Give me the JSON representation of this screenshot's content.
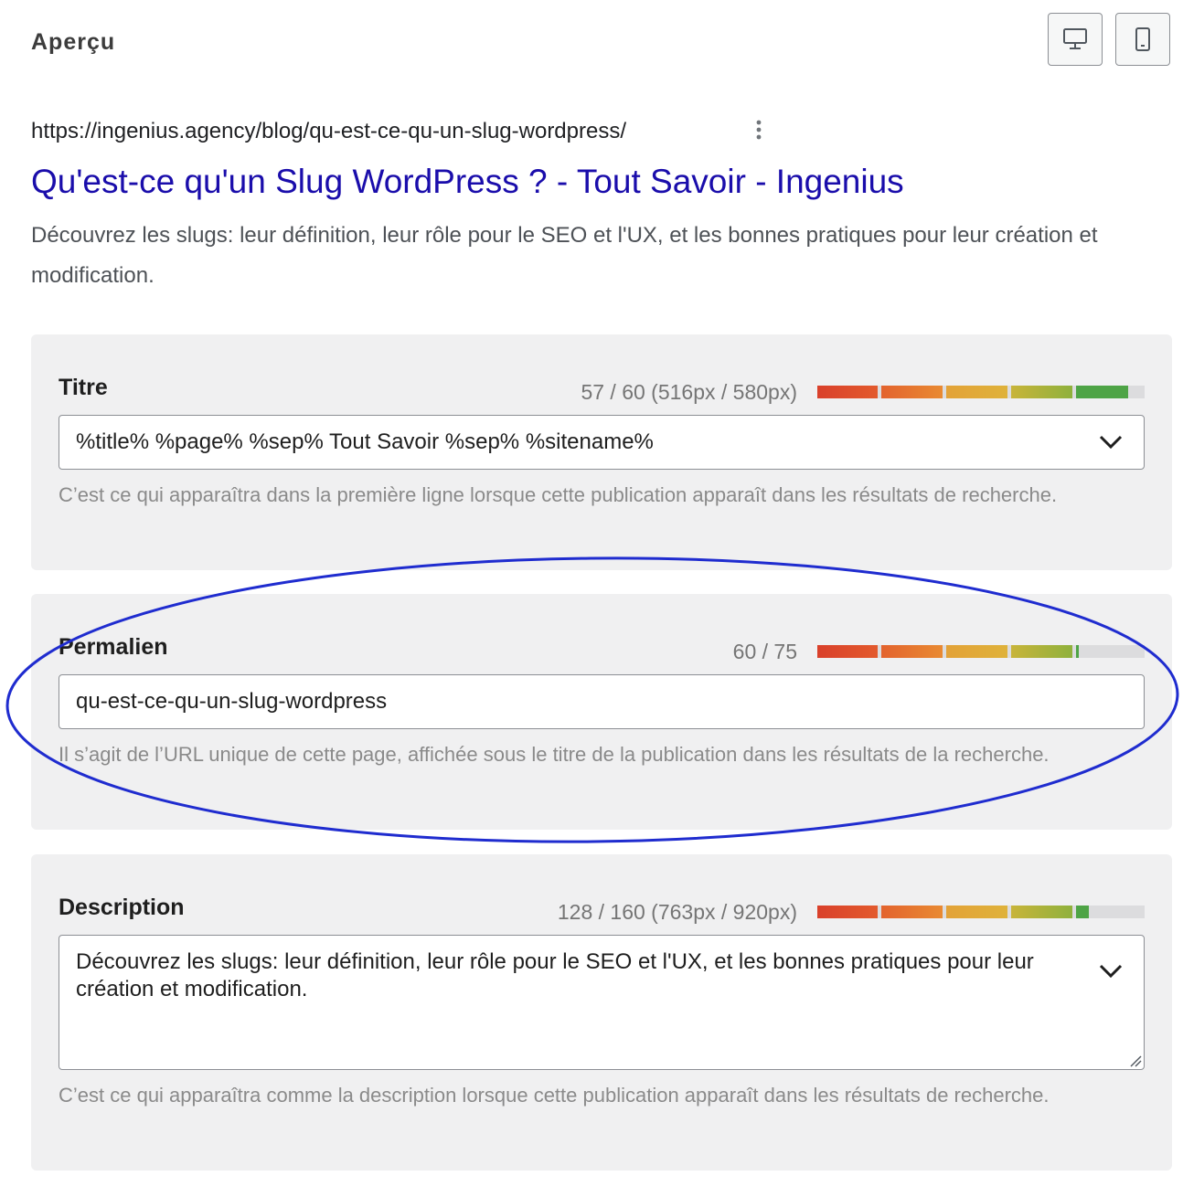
{
  "header": {
    "title": "Aperçu"
  },
  "view_toggle": {
    "desktop_icon": "desktop-icon",
    "mobile_icon": "mobile-icon"
  },
  "preview": {
    "url": "https://ingenius.agency/blog/qu-est-ce-qu-un-slug-wordpress/",
    "title": "Qu'est-ce qu'un Slug WordPress ? - Tout Savoir - Ingenius",
    "description": "Découvrez les slugs: leur définition, leur rôle pour le SEO et l'UX, et les bonnes pratiques pour leur création et modification."
  },
  "fields": {
    "title": {
      "label": "Titre",
      "counter": "57 / 60 (516px / 580px)",
      "progress": 0.95,
      "value": "%title% %page% %sep% Tout Savoir %sep% %sitename%",
      "help": "C’est ce qui apparaîtra dans la première ligne lorsque cette publication apparaît dans les résultats de recherche."
    },
    "permalink": {
      "label": "Permalien",
      "counter": "60 / 75",
      "progress": 0.8,
      "value": "qu-est-ce-qu-un-slug-wordpress",
      "help": "Il s’agit de l’URL unique de cette page, affichée sous le titre de la publication dans les résultats de la recherche."
    },
    "description": {
      "label": "Description",
      "counter": "128 / 160 (763px / 920px)",
      "progress": 0.83,
      "value": "Découvrez les slugs: leur définition, leur rôle pour le SEO et l'UX, et les bonnes pratiques pour leur création et modification.",
      "help": "C’est ce qui apparaîtra comme la description lorsque cette publication apparaît dans les résultats de recherche."
    }
  },
  "colors": {
    "link_blue": "#1a0dab",
    "highlight_ellipse": "#1f2ccf",
    "meter_good": "#4ea446"
  }
}
